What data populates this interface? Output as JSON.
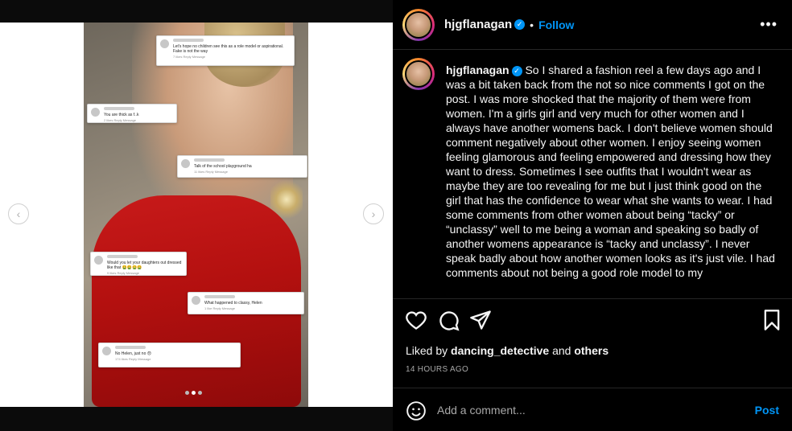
{
  "media": {
    "comments": [
      {
        "text": "Let's hope no children see this as a role model or aspirational. Fake is not the way",
        "meta": "7 likes   Reply   Message"
      },
      {
        "text": "You are thick as f..k",
        "meta": "2 likes   Reply   Message"
      },
      {
        "text": "Talk of the school playground ha",
        "meta": "11 likes   Reply   Message"
      },
      {
        "text": "Would you let your daughters out dressed like that 🤮🤮🤮🤮",
        "meta": "9 likes   Reply   Message"
      },
      {
        "text": "What happened to classy, Helen",
        "meta": "1 like   Reply   Message"
      },
      {
        "text": "No Helen, just no 😠",
        "meta": "174 likes   Reply   Message"
      }
    ],
    "prev_arrow": "‹",
    "next_arrow": "›"
  },
  "header": {
    "username": "hjgflanagan",
    "separator": "•",
    "follow_label": "Follow",
    "more": "•••"
  },
  "caption": {
    "username": "hjgflanagan",
    "text": "So I shared a fashion reel a few days ago and I was a bit taken back from the not so nice comments I got on the post. I was more shocked that the majority of them were from women. I'm a girls girl and very much for other women and I always have another womens back. I don't believe women should comment negatively about other women. I enjoy seeing women feeling glamorous and feeling empowered and dressing how they want to dress. Sometimes I see outfits that I wouldn't wear as maybe they are too revealing for me but I just think good on the girl that has the confidence to wear what she wants to wear. I had some comments from other women about being “tacky” or “unclassy” well to me being a woman and speaking so badly of another womens appearance is “tacky and unclassy”. I never speak badly about how another women looks as it's just vile. I had comments about not being a good role model to my"
  },
  "engagement": {
    "liked_prefix": "Liked by",
    "liked_user": "dancing_detective",
    "liked_and": "and",
    "liked_others": "others",
    "timestamp": "14 HOURS AGO"
  },
  "comment_box": {
    "placeholder": "Add a comment...",
    "post_label": "Post"
  },
  "icons": [
    "heart-icon",
    "comment-icon",
    "share-icon",
    "bookmark-icon",
    "emoji-icon",
    "verified-badge-icon",
    "more-options-icon",
    "chevron-left-icon",
    "chevron-right-icon"
  ],
  "colors": {
    "accent": "#0095f6",
    "background": "#000000",
    "text": "#f5f5f5",
    "muted": "#a8a8a8"
  }
}
